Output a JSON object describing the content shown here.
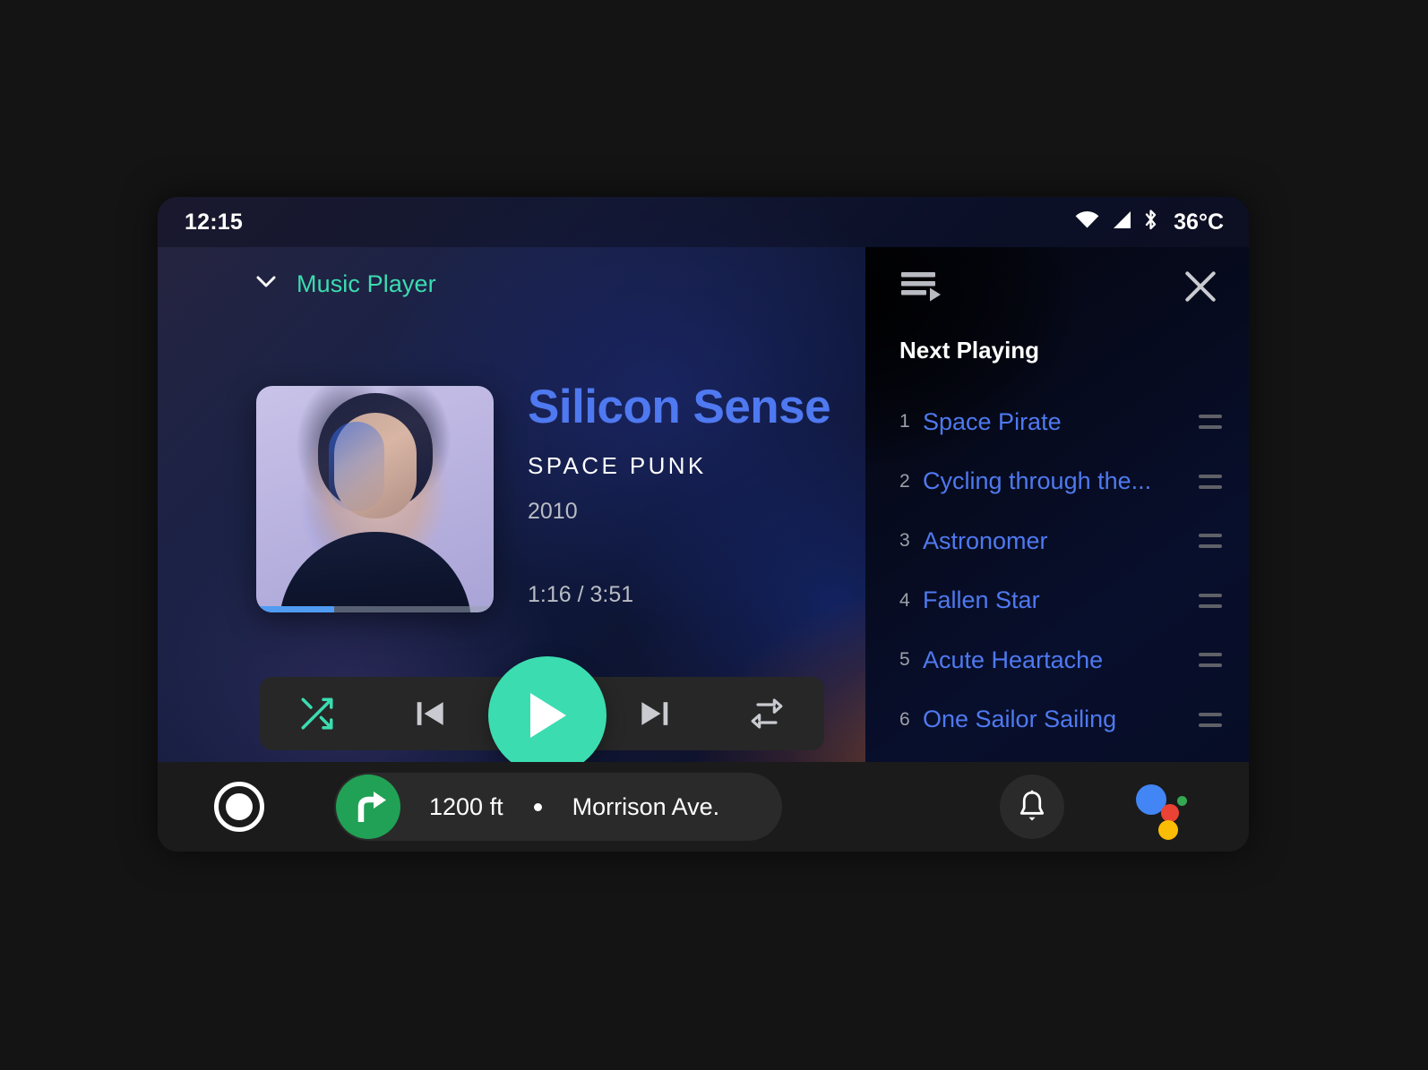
{
  "status_bar": {
    "time": "12:15",
    "temperature": "36°C",
    "icons": [
      "wifi-icon",
      "cellular-signal-icon",
      "bluetooth-icon"
    ]
  },
  "app_header": {
    "collapse_icon": "chevron-down-icon",
    "app_name": "Music Player"
  },
  "now_playing": {
    "title": "Silicon Sense",
    "artist": "SPACE PUNK",
    "year": "2010",
    "time_display": "1:16 / 3:51",
    "elapsed": "1:16",
    "duration": "3:51",
    "progress_percent": 33,
    "album_art_alt": "Portrait of a woman lit with blue light on a lavender background"
  },
  "transport": {
    "shuffle_label": "Shuffle",
    "previous_label": "Previous track",
    "play_label": "Play",
    "next_label": "Next track",
    "repeat_label": "Repeat",
    "shuffle_active": true,
    "accent_color": "#3bdcb0"
  },
  "queue": {
    "queue_icon": "playlist-queue-icon",
    "close_icon": "close-icon",
    "heading": "Next Playing",
    "tracks": [
      {
        "number": "1",
        "name": "Space Pirate"
      },
      {
        "number": "2",
        "name": "Cycling through the..."
      },
      {
        "number": "3",
        "name": "Astronomer"
      },
      {
        "number": "4",
        "name": "Fallen Star"
      },
      {
        "number": "5",
        "name": "Acute Heartache"
      },
      {
        "number": "6",
        "name": "One Sailor Sailing"
      }
    ]
  },
  "bottom_bar": {
    "home_label": "Home",
    "navigation": {
      "maneuver_icon": "turn-right-icon",
      "distance": "1200 ft",
      "separator": "•",
      "street": "Morrison Ave."
    },
    "notifications_label": "Notifications",
    "assistant_label": "Google Assistant"
  },
  "colors": {
    "accent_teal": "#3bdcb0",
    "track_blue": "#4f79f0",
    "nav_green": "#21a155",
    "bar_dark": "#272727"
  }
}
